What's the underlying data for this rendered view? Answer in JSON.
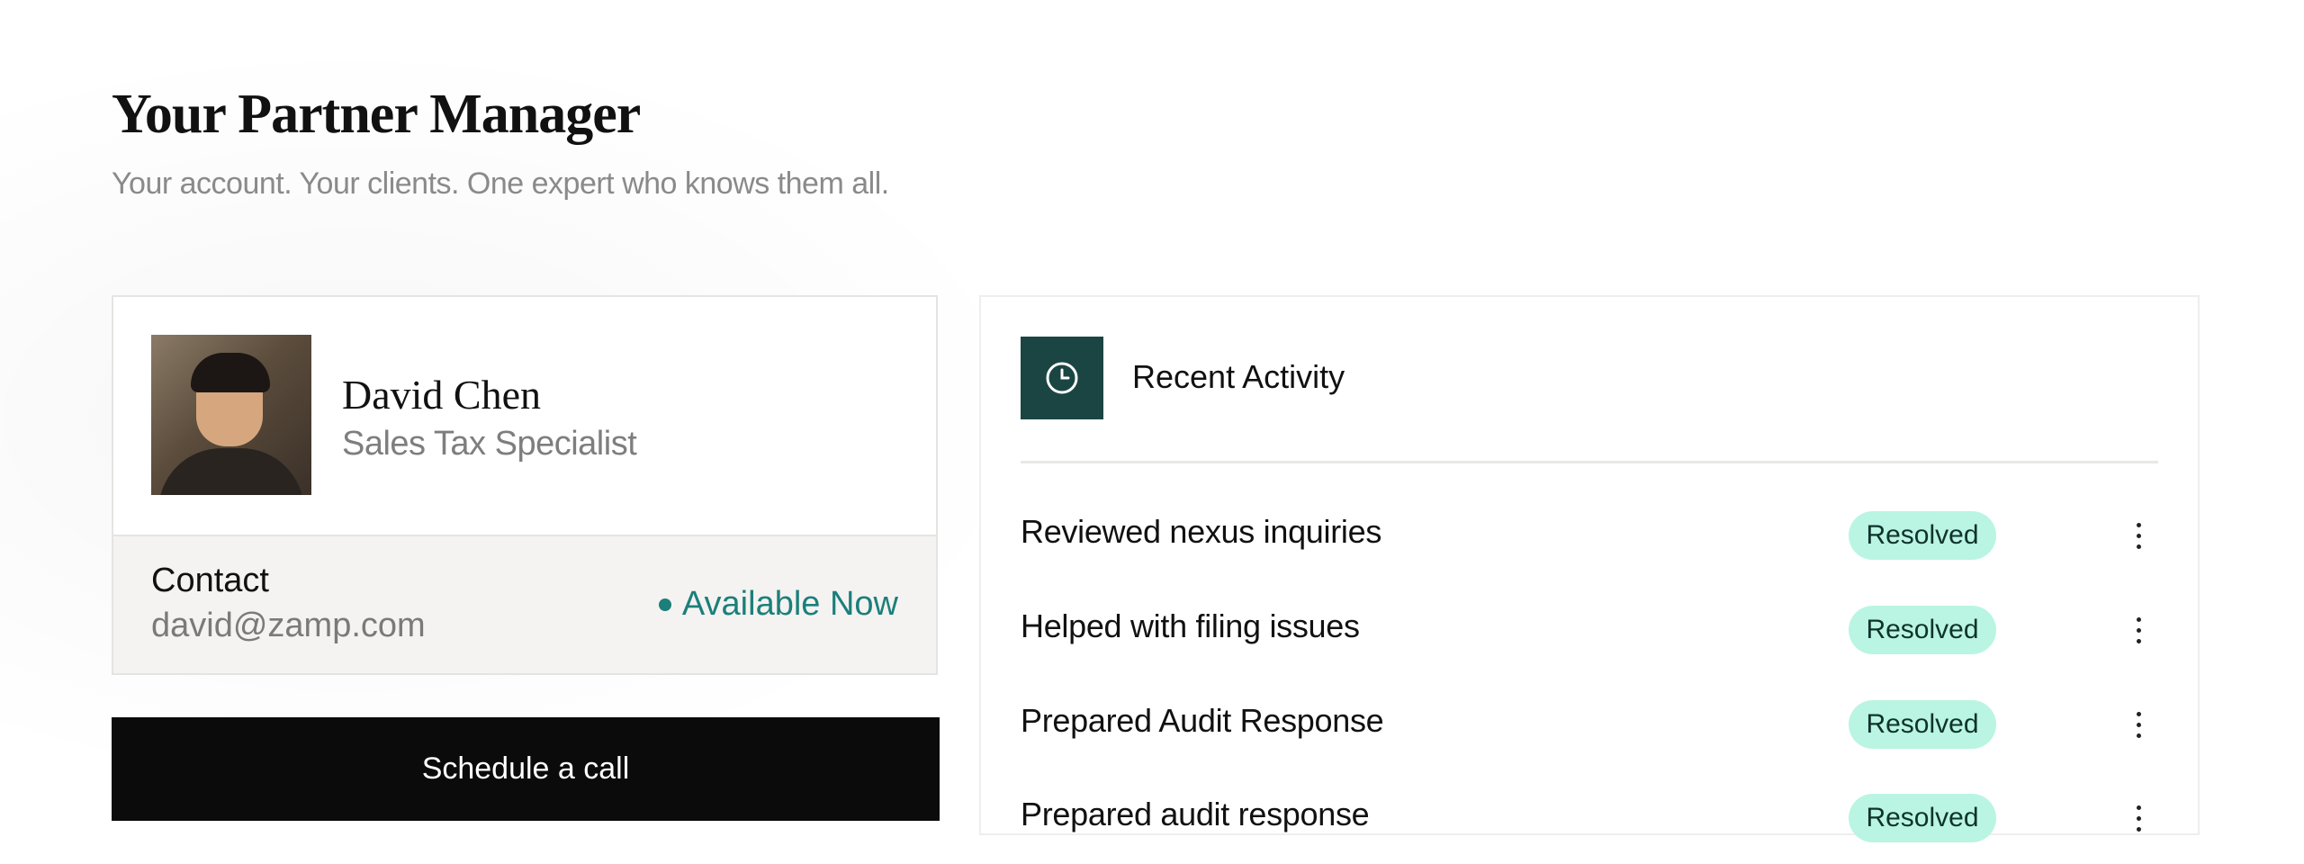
{
  "header": {
    "title": "Your Partner Manager",
    "subtitle": "Your account. Your clients. One expert who knows them all."
  },
  "manager": {
    "name": "David Chen",
    "role": "Sales Tax Specialist",
    "contact_label": "Contact",
    "email": "david@zamp.com",
    "availability": "Available Now",
    "availability_color": "#1c7f7a"
  },
  "actions": {
    "schedule_label": "Schedule a call"
  },
  "activity": {
    "title": "Recent Activity",
    "icon": "clock-icon",
    "items": [
      {
        "label": "Reviewed nexus inquiries",
        "status": "Resolved"
      },
      {
        "label": "Helped with filing issues",
        "status": "Resolved"
      },
      {
        "label": "Prepared Audit Response",
        "status": "Resolved"
      },
      {
        "label": "Prepared audit response",
        "status": "Resolved"
      }
    ]
  },
  "colors": {
    "accent_dark": "#1b4543",
    "badge_bg": "#b9f5e2",
    "button_bg": "#0b0b0b"
  }
}
